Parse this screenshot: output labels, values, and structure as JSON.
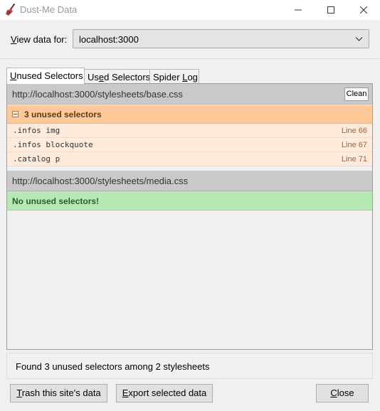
{
  "window": {
    "title": "Dust-Me Data"
  },
  "colors": {
    "accent_orange": "#ffc999",
    "selector_row_bg": "#ffebdb",
    "success_green": "#b6e8b4",
    "header_gray": "#c9c9c9"
  },
  "icons": {
    "app": "broom-icon",
    "minimize": "minimize-icon",
    "maximize": "maximize-icon",
    "close": "close-icon",
    "dropdown": "chevron-down-icon",
    "collapse": "collapse-minus-icon"
  },
  "view": {
    "label_accel": "V",
    "label_rest": "iew data for:",
    "selected_site": "localhost:3000"
  },
  "tabs": [
    {
      "accel": "U",
      "rest": "nused Selectors",
      "pre": ""
    },
    {
      "pre": "Us",
      "accel": "e",
      "rest": "d Selectors"
    },
    {
      "pre": "Spider ",
      "accel": "L",
      "rest": "og"
    }
  ],
  "stylesheets": [
    {
      "url": "http://localhost:3000/stylesheets/base.css",
      "clean_label": "Clean",
      "group_label": "3 unused selectors",
      "selectors": [
        {
          "selector": ".infos img",
          "line": "Line 66"
        },
        {
          "selector": ".infos blockquote",
          "line": "Line 67"
        },
        {
          "selector": ".catalog p",
          "line": "Line 71"
        }
      ]
    },
    {
      "url": "http://localhost:3000/stylesheets/media.css",
      "message": "No unused selectors!"
    }
  ],
  "status": {
    "text": "Found 3 unused selectors among 2 stylesheets"
  },
  "buttons": {
    "trash": {
      "accel": "T",
      "rest": "rash this site's data"
    },
    "export": {
      "accel": "E",
      "rest": "xport selected data"
    },
    "close": {
      "accel": "C",
      "rest": "lose"
    }
  }
}
